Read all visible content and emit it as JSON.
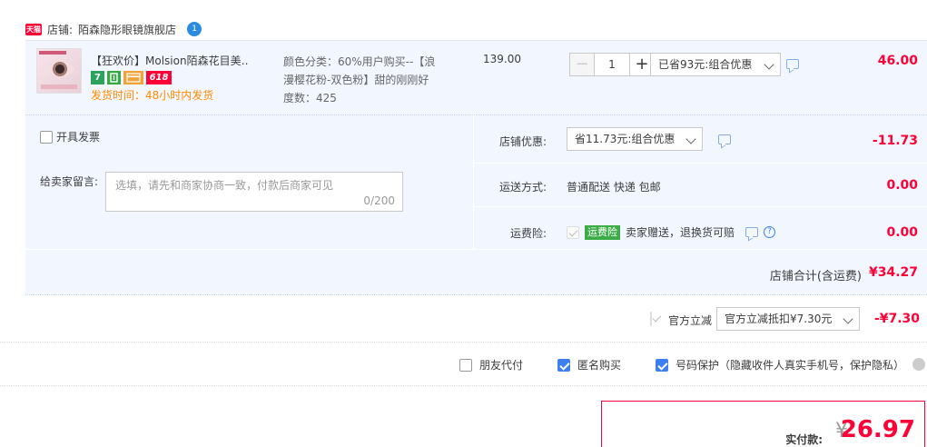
{
  "shop": {
    "tmall_badge": "天猫",
    "label": "店铺:",
    "name": "陌森隐形眼镜旗舰店",
    "chat_badge": "1"
  },
  "item": {
    "title": "【狂欢价】Molsion陌森花目美…",
    "badges": [
      "7",
      "",
      "",
      "618"
    ],
    "ship_time": "发货时间：48小时内发货",
    "sku_lines": [
      "颜色分类：60%用户购买--【浪",
      "漫樱花粉-双色粉】甜的刚刚好",
      "度数：425"
    ],
    "unit_price": "139.00",
    "qty_minus": "−",
    "qty_value": "1",
    "qty_plus": "+",
    "discount_select": "已省93元:组合优惠",
    "row_total": "46.00"
  },
  "summary": {
    "invoice_label": "开具发票",
    "memo_label": "给卖家留言:",
    "memo_placeholder": "选填，请先和商家协商一致，付款后商家可见",
    "memo_count": "0/200",
    "shop_discount_label": "店铺优惠:",
    "shop_discount_select": "省11.73元:组合优惠",
    "shop_discount_value": "-11.73",
    "shipping_label": "运送方式:",
    "shipping_method": "普通配送 快递 包邮",
    "shipping_value": "0.00",
    "freight_label": "运费险:",
    "freight_badge": "运费险",
    "freight_text": "卖家赠送，退换货可赔",
    "freight_value": "0.00",
    "shop_total_label": "店铺合计(含运费)",
    "shop_total_value": "¥34.27"
  },
  "direct_discount": {
    "label": "官方立减",
    "select": "官方立减抵扣¥7.30元",
    "value": "-¥7.30"
  },
  "options": {
    "friend_pay": "朋友代付",
    "anonymous": "匿名购买",
    "number_protect": "号码保护（隐藏收件人真实手机号，保护隐私）"
  },
  "payment": {
    "label": "实付款:",
    "currency": "¥",
    "amount": "26.97"
  },
  "colors": {
    "accent_red": "#ff0036",
    "panel_blue": "#f2f7ff",
    "checkbox_blue": "#3d7ff2",
    "ship_orange": "#ff8a00"
  }
}
